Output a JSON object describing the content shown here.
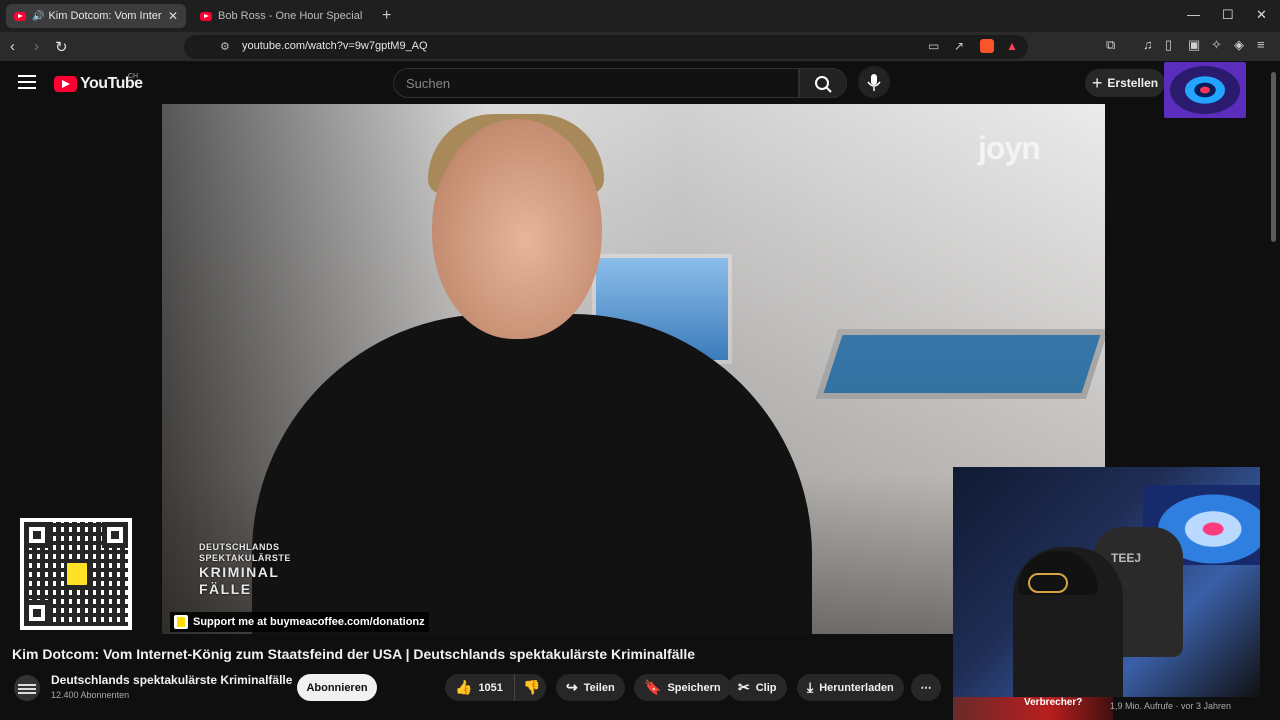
{
  "browser": {
    "tabs": [
      {
        "title": "Kim Dotcom: Vom Internet-K",
        "active": true
      },
      {
        "title": "Bob Ross - One Hour Special - The G",
        "active": false
      }
    ],
    "url": "youtube.com/watch?v=9w7gptM9_AQ"
  },
  "youtube": {
    "logo_text": "YouTube",
    "country": "CH",
    "search_placeholder": "Suchen",
    "create_label": "Erstellen"
  },
  "video": {
    "watermark": "joyn",
    "show_logo": [
      "DEUTSCHLANDS",
      "SPEKTAKULÄRSTE",
      "KRIMINAL",
      "FÄLLE"
    ],
    "support_text": "Support me at buymeacoffee.com/donationz",
    "webcam_caption": "Verbrecher?",
    "webcam_chair_text": "TEEJ"
  },
  "details": {
    "title": "Kim Dotcom: Vom Internet-König zum Staatsfeind der USA | Deutschlands spektakulärste Kriminalfälle",
    "channel": "Deutschlands spektakulärste Kriminalfälle",
    "subscribers": "12.400 Abonnenten",
    "subscribe_label": "Abonnieren",
    "likes": "1051",
    "share": "Teilen",
    "save": "Speichern",
    "clip": "Clip",
    "download": "Herunterladen",
    "views_age": "1,9 Mio. Aufrufe · vor 3 Jahren"
  },
  "colors": {
    "accent": "#ff0033",
    "bg": "#0f0f0f",
    "pill": "#272727"
  }
}
